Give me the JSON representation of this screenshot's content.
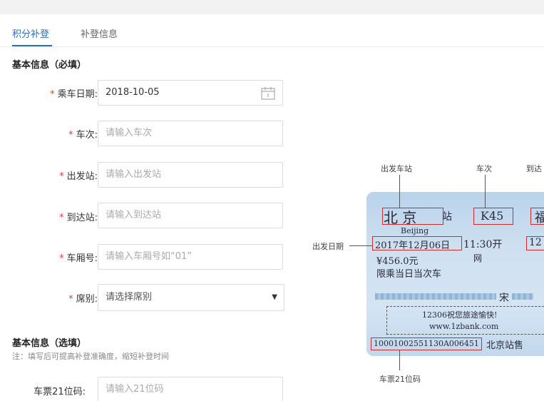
{
  "tabs": [
    {
      "label": "积分补登"
    },
    {
      "label": "补登信息"
    }
  ],
  "section_required": "基本信息（必填）",
  "section_optional": "基本信息（选填）",
  "optional_note": "注：填写后可提高补登准确度，缩短补登时间",
  "required_mark": "*",
  "fields": {
    "date": {
      "label": "乘车日期:",
      "value": "2018-10-05"
    },
    "train": {
      "label": "车次:",
      "placeholder": "请输入车次"
    },
    "depart": {
      "label": "出发站:",
      "placeholder": "请输入出发站"
    },
    "arrive": {
      "label": "到达站:",
      "placeholder": "请输入到达站"
    },
    "carriage": {
      "label": "车厢号:",
      "placeholder": "请输入车厢号如“01”"
    },
    "seat": {
      "label": "席别:",
      "value": "请选择席别"
    },
    "ticket_code": {
      "label": "车票21位码:",
      "placeholder": "请输入21位码"
    }
  },
  "ticket_diagram": {
    "callouts": {
      "depart_station": "出发车站",
      "train_no": "车次",
      "arrive_station": "到达",
      "depart_date": "出发日期",
      "code": "车票21位码"
    },
    "ticket": {
      "station_from": "北  京",
      "station_suffix": "站",
      "pinyin": "Beijing",
      "train": "K45",
      "to_partial": "福",
      "date": "2017年12月06日",
      "time": "11:30开",
      "date_partial": "12",
      "price": "¥456.0元",
      "class_partial": "网",
      "restriction": "限乘当日当次车",
      "name_partial": "宋",
      "slogan": "12306祝您旅途愉快!",
      "site": "www.1zbank.com",
      "code": "10001002551130A006451",
      "issuer": "北京站售"
    }
  },
  "colors": {
    "accent": "#2d6fb4",
    "required": "#e23b3b",
    "highlight_box": "#d12b2b"
  }
}
